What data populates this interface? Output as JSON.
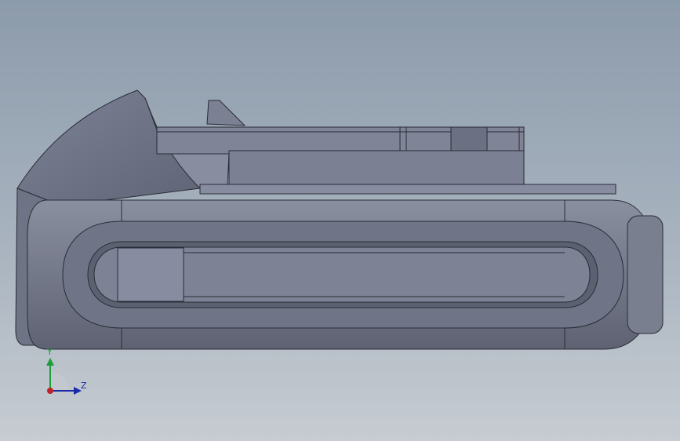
{
  "viewport": {
    "background_top": "#8c9bab",
    "background_bottom": "#c7ccd2"
  },
  "model": {
    "type": "battery-pack-3d-model",
    "view": "side",
    "body_color": "#7a7f8e",
    "edge_color": "#2a2d36"
  },
  "triad": {
    "y_label": "Y",
    "z_label": "Z",
    "y_color": "#1e9e3a",
    "z_color": "#1a2aa8",
    "origin_color": "#c0202a"
  }
}
